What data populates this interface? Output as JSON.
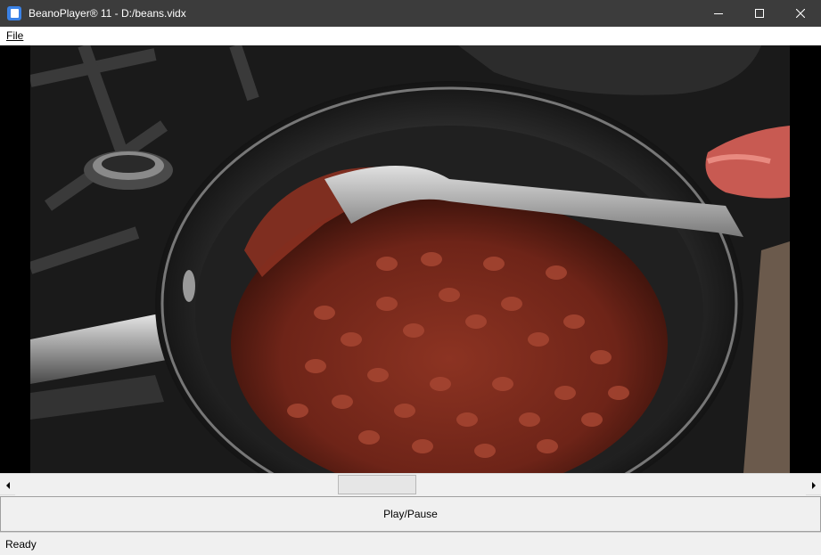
{
  "window": {
    "title": "BeanoPlayer® 11 - D:/beans.vidx",
    "minimize_icon": "minimize-icon",
    "maximize_icon": "maximize-icon",
    "close_icon": "close-icon"
  },
  "menu": {
    "items": [
      {
        "label": "File",
        "mnemonic": "F"
      }
    ]
  },
  "video": {
    "content": "pot of baked beans being stirred with a spoon on a stovetop"
  },
  "seek": {
    "position_fraction": 0.455
  },
  "controls": {
    "play_pause_label": "Play/Pause"
  },
  "status": {
    "text": "Ready"
  },
  "colors": {
    "titlebar": "#3c3c3c",
    "app_icon": "#3b82e6",
    "beans": "#7a2a1c",
    "pot": "#1e1e1e"
  }
}
